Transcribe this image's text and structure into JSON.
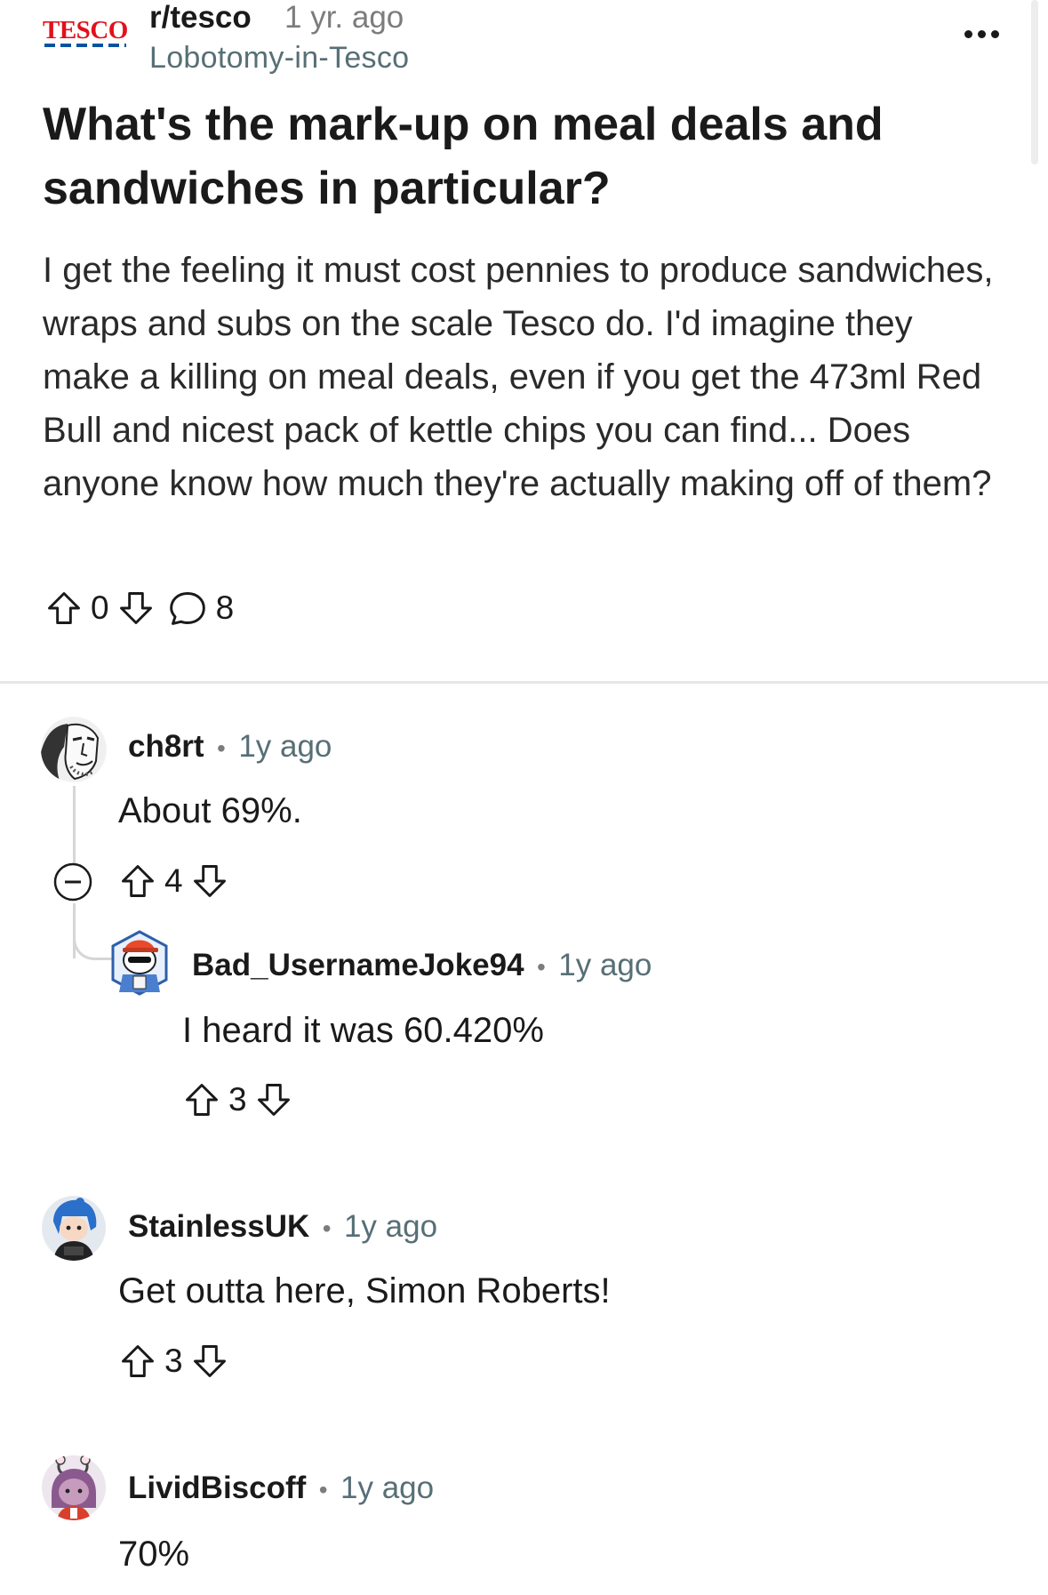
{
  "post": {
    "subreddit": "r/tesco",
    "age": "1 yr. ago",
    "author": "Lobotomy-in-Tesco",
    "logo_text": "TESCO",
    "title": "What's the mark-up on meal deals and sandwiches in particular?",
    "body": "I get the feeling it must cost pennies to produce sandwiches, wraps and subs on the scale Tesco do. I'd imagine they make a killing on meal deals, even if you get the 473ml Red Bull and nicest pack of kettle chips you can find... Does anyone know how much they're actually making off of them?",
    "votes": "0",
    "comment_count": "8"
  },
  "separator": "•",
  "comments": [
    {
      "username": "ch8rt",
      "age": "1y ago",
      "text": "About 69%.",
      "votes": "4",
      "replies": [
        {
          "username": "Bad_UsernameJoke94",
          "age": "1y ago",
          "text": "I heard it was 60.420%",
          "votes": "3"
        }
      ]
    },
    {
      "username": "StainlessUK",
      "age": "1y ago",
      "text": "Get outta here, Simon Roberts!",
      "votes": "3"
    },
    {
      "username": "LividBiscoff",
      "age": "1y ago",
      "text": "70%"
    }
  ],
  "colors": {
    "tesco_red": "#e3101b",
    "tesco_blue": "#00539f",
    "text": "#1a1a1b",
    "meta": "#576f76"
  }
}
